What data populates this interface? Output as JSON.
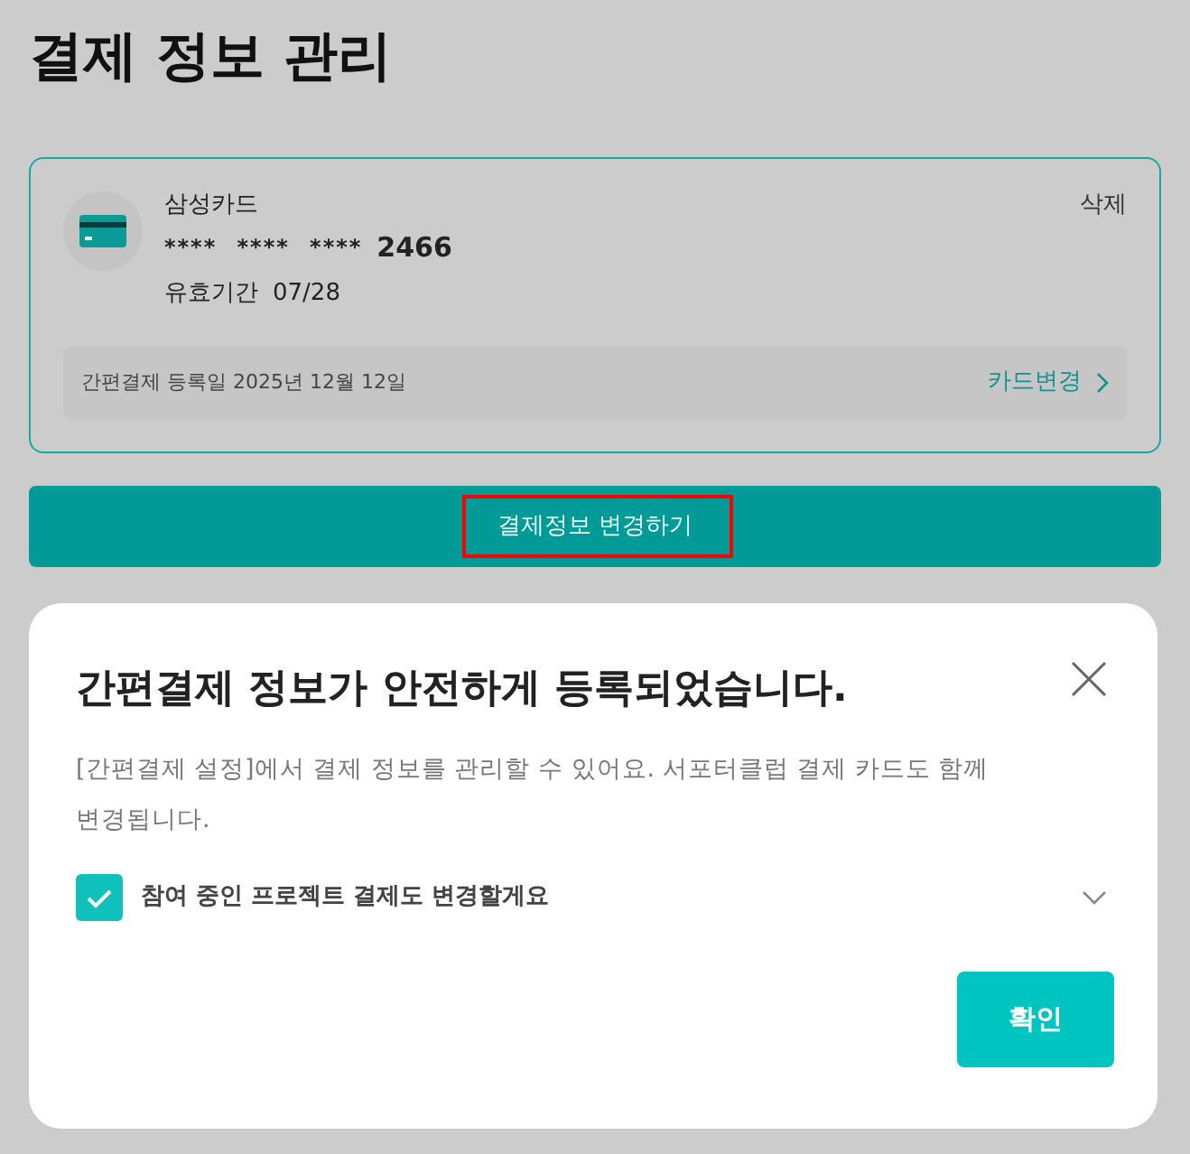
{
  "page": {
    "title": "결제 정보 관리"
  },
  "card": {
    "issuer": "삼성카드",
    "masked_number": "**** **** ****",
    "last_digits": "2466",
    "expiry_label": "유효기간",
    "expiry": "07/28",
    "delete": "삭제",
    "registered": "간편결제 등록일 2025년 12월 12일",
    "change": "카드변경"
  },
  "primary_button": {
    "label": "결제정보 변경하기",
    "highlighted": true
  },
  "dialog": {
    "title": "간편결제 정보가 안전하게 등록되었습니다.",
    "message": "[간편결제 설정]에서 결제 정보를 관리할 수 있어요. 서포터클럽 결제 카드도 함께 변경됩니다.",
    "checkbox": {
      "label": "참여 중인 프로젝트 결제도 변경할게요",
      "checked": true,
      "expanded": false
    },
    "confirm": "확인"
  }
}
